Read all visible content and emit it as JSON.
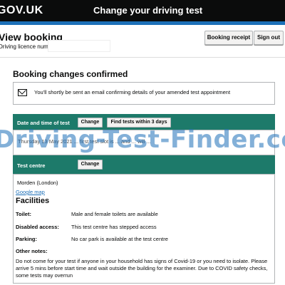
{
  "header": {
    "logo": "GOV.UK",
    "service_name": "Change your driving test"
  },
  "page": {
    "title": "View booking",
    "licence_label": "Driving licence number: KAPKO",
    "booking_receipt_button": "Booking receipt",
    "sign_out_button": "Sign out"
  },
  "confirmation": {
    "heading": "Booking changes confirmed",
    "email_icon": "envelope-icon",
    "email_text": "You'll shortly be sent an email confirming details of your amended test appointment"
  },
  "date_section": {
    "label": "Date and time of test",
    "change_button": "Change",
    "find_button": "Find tests within 3 days",
    "row_text": "Thursday 13 May 2021 ... first test slot is ... and ... will ..."
  },
  "centre_section": {
    "label": "Test centre",
    "change_button": "Change",
    "centre_name": "Morden (London)",
    "map_link": "Google map"
  },
  "facilities": {
    "heading": "Facilities",
    "rows": [
      {
        "label": "Toilet:",
        "value": "Male and female toilets are available"
      },
      {
        "label": "Disabled access:",
        "value": "This test centre has stepped access"
      },
      {
        "label": "Parking:",
        "value": "No car park is available at the test centre"
      },
      {
        "label": "Other notes:",
        "value": ""
      }
    ],
    "notes": "Do not come for your test if anyone in your household has signs of Covid-19 or you need to isolate. Please arrive 5 mins before start time and wait outside the building for the examiner. Due to COVID safety checks, some tests may overrun"
  },
  "watermark": "Driving-Test-Finder.co"
}
